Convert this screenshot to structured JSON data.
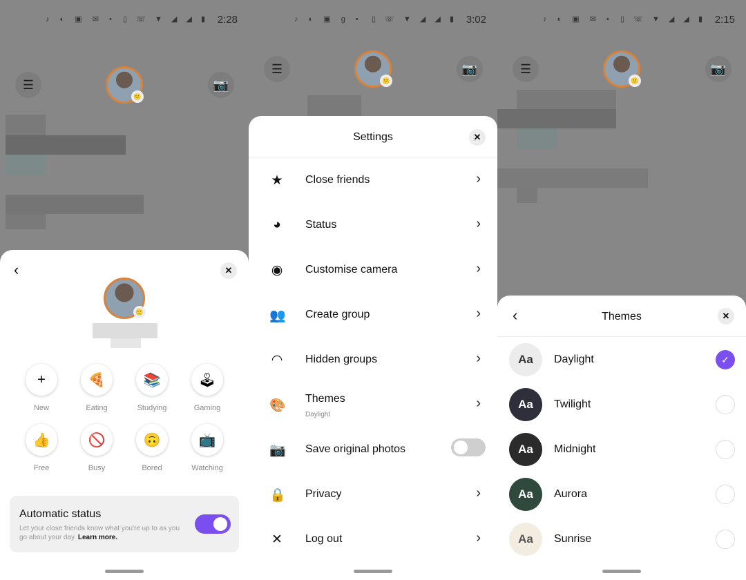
{
  "panels": [
    {
      "time": "2:28"
    },
    {
      "time": "3:02"
    },
    {
      "time": "2:15"
    }
  ],
  "status_panel": {
    "statuses": [
      {
        "label": "New",
        "icon": "+"
      },
      {
        "label": "Eating",
        "icon": "🍕"
      },
      {
        "label": "Studying",
        "icon": "📚"
      },
      {
        "label": "Gaming",
        "icon": "🕹"
      },
      {
        "label": "Free",
        "icon": "👍"
      },
      {
        "label": "Busy",
        "icon": "🚫"
      },
      {
        "label": "Bored",
        "icon": "🙃"
      },
      {
        "label": "Watching",
        "icon": "📺"
      }
    ],
    "auto_title": "Automatic status",
    "auto_desc": "Let your close friends know what you're up to as you go about your day.",
    "learn_more": "Learn more.",
    "auto_enabled": true,
    "accent": "#7b4ef0"
  },
  "settings": {
    "title": "Settings",
    "items": [
      {
        "label": "Close friends",
        "icon": "★"
      },
      {
        "label": "Status",
        "icon": "◕"
      },
      {
        "label": "Customise camera",
        "icon": "◉"
      },
      {
        "label": "Create group",
        "icon": "👥"
      },
      {
        "label": "Hidden groups",
        "icon": "◠"
      },
      {
        "label": "Themes",
        "sub": "Daylight",
        "icon": "🎨"
      },
      {
        "label": "Save original photos",
        "icon": "📷",
        "toggle": false
      },
      {
        "label": "Privacy",
        "icon": "🔒"
      },
      {
        "label": "Log out",
        "icon": "✕"
      }
    ]
  },
  "themes": {
    "title": "Themes",
    "items": [
      {
        "label": "Daylight",
        "bg": "#ececec",
        "fg": "#333",
        "selected": true
      },
      {
        "label": "Twilight",
        "bg": "#2f2f3b",
        "fg": "#fff",
        "selected": false
      },
      {
        "label": "Midnight",
        "bg": "#2b2b2b",
        "fg": "#fff",
        "selected": false
      },
      {
        "label": "Aurora",
        "bg": "#2f4a3c",
        "fg": "#fff",
        "selected": false
      },
      {
        "label": "Sunrise",
        "bg": "#f3ece0",
        "fg": "#555",
        "selected": false
      }
    ],
    "aa": "Aa"
  }
}
